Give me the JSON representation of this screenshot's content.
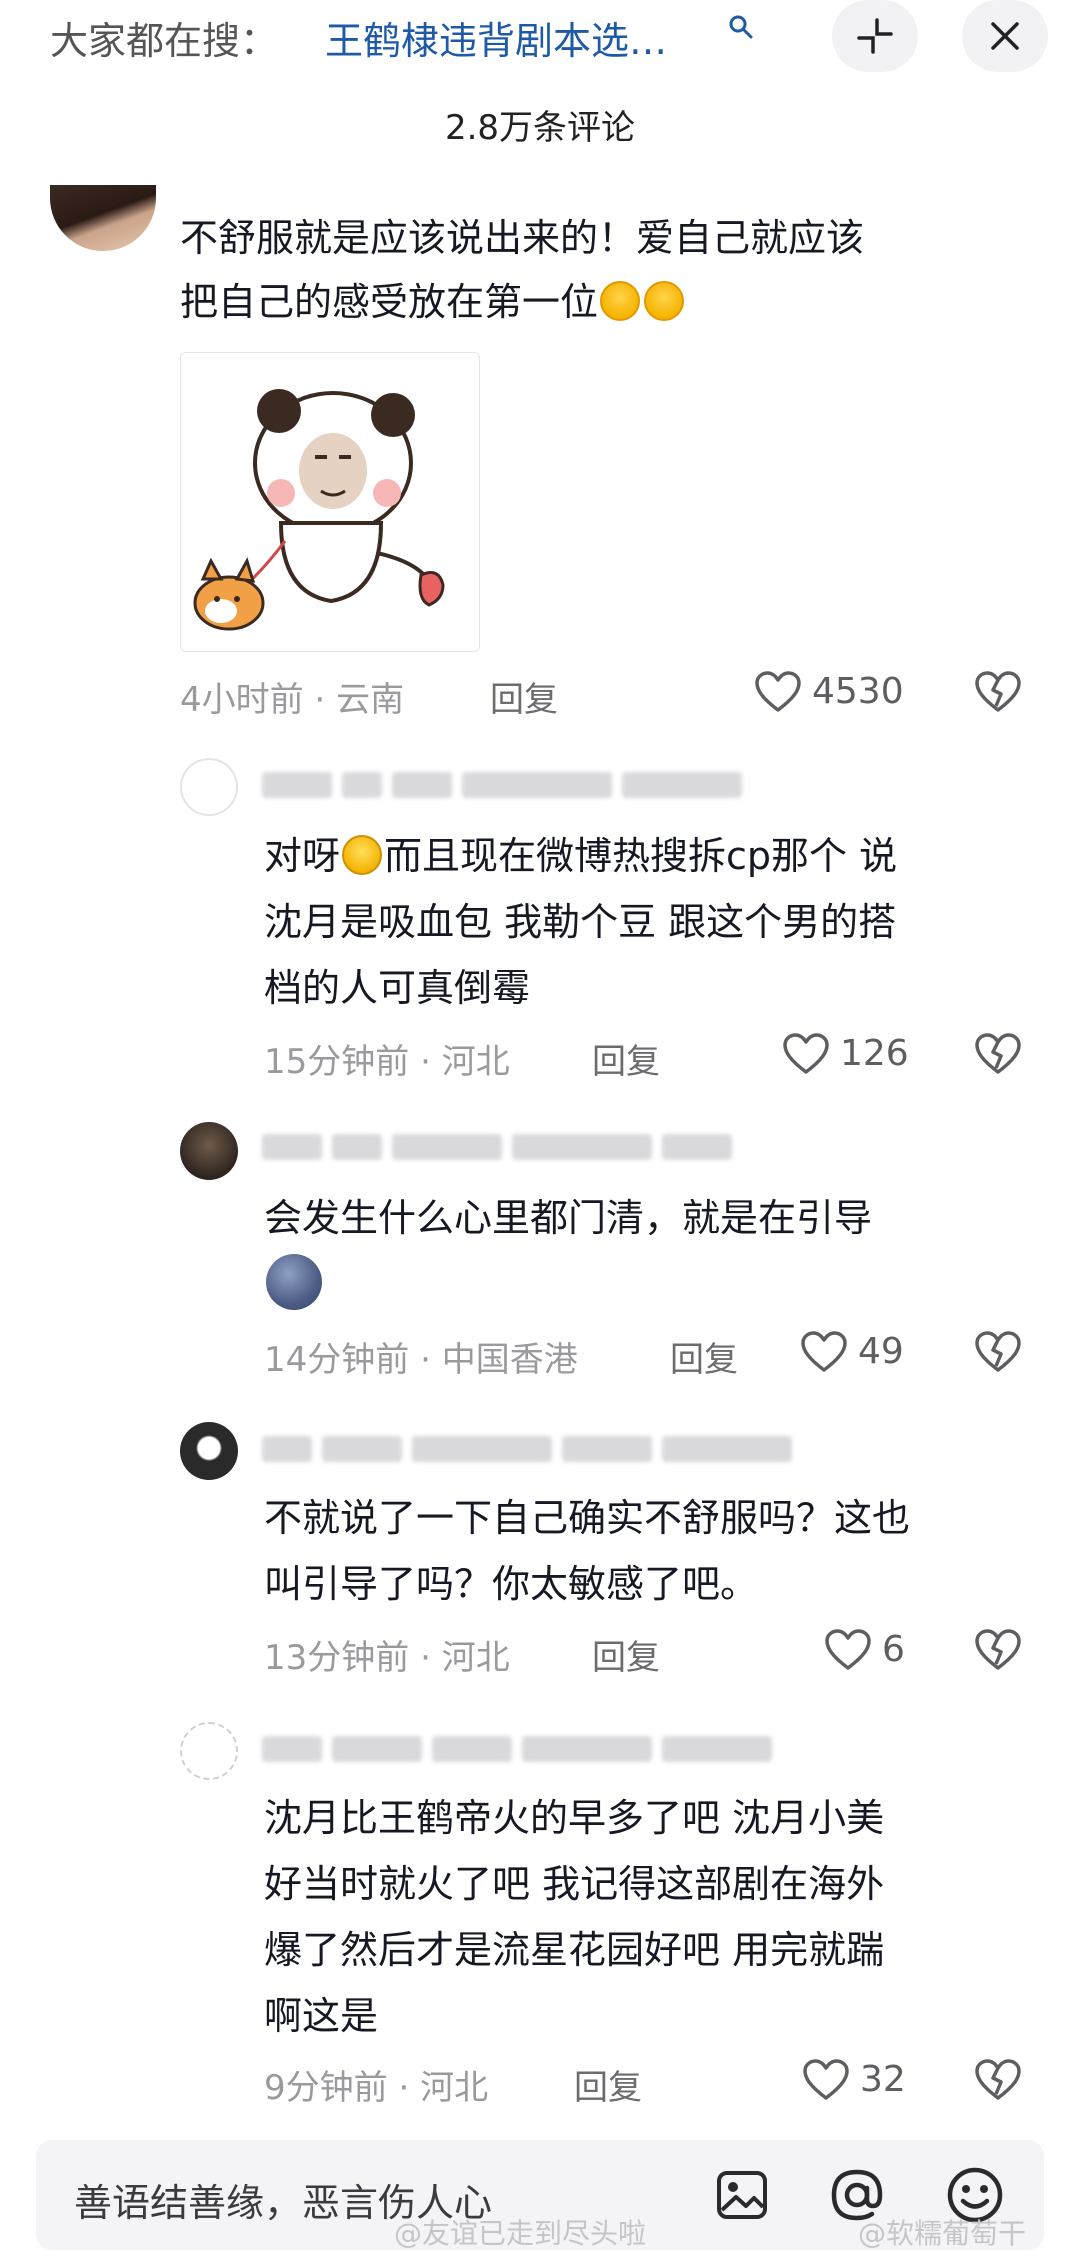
{
  "search": {
    "prefix": "大家都在搜：",
    "term": "王鹤棣违背剧本选…"
  },
  "header": {
    "comment_count": "2.8万条评论"
  },
  "comments": [
    {
      "lines": [
        "不舒服就是应该说出来的！爱自己就应该",
        "把自己的感受放在第一位"
      ],
      "emoji": [
        "shy-face",
        "shy-face"
      ],
      "time": "4小时前",
      "location": "云南",
      "reply": "回复",
      "likes": "4530"
    },
    {
      "lines_a": "对呀",
      "lines_a2": "而且现在微博热搜拆cp那个 说",
      "lines": [
        "沈月是吸血包 我勒个豆 跟这个男的搭",
        "档的人可真倒霉"
      ],
      "time": "15分钟前",
      "location": "河北",
      "reply": "回复",
      "likes": "126"
    },
    {
      "lines": [
        "会发生什么心里都门清，就是在引导"
      ],
      "time": "14分钟前",
      "location": "中国香港",
      "reply": "回复",
      "likes": "49"
    },
    {
      "lines": [
        "不就说了一下自己确实不舒服吗？这也",
        "叫引导了吗？你太敏感了吧。"
      ],
      "time": "13分钟前",
      "location": "河北",
      "reply": "回复",
      "likes": "6"
    },
    {
      "lines": [
        "沈月比王鹤帝火的早多了吧 沈月小美",
        "好当时就火了吧 我记得这部剧在海外",
        "爆了然后才是流星花园好吧 用完就踹",
        "啊这是"
      ],
      "time": "9分钟前",
      "location": "河北",
      "reply": "回复",
      "likes": "32"
    }
  ],
  "input": {
    "placeholder": "善语结善缘，恶言伤人心"
  },
  "watermarks": [
    "@友谊已走到尽头啦",
    "@软糯葡萄干"
  ],
  "colors": {
    "search_term": "#1e5aa6",
    "meta_text": "#9a9a9e",
    "input_bg": "#f4f4f6"
  }
}
